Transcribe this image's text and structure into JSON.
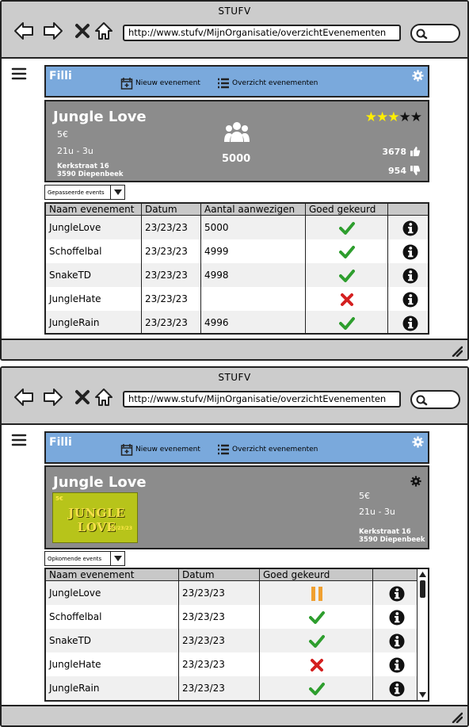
{
  "browser": {
    "title": "STUFV",
    "url": "http://www.stufv/MijnOrganisatie/overzichtEvenementen"
  },
  "app": {
    "brand": "Filli",
    "nav": {
      "new_event": "Nieuw evenement",
      "overview": "Overzicht evenementen"
    }
  },
  "screen1": {
    "event": {
      "title": "Jungle Love",
      "price": "5€",
      "time": "21u - 3u",
      "address_line1": "Kerkstraat 16",
      "address_line2": "3590 Diepenbeek",
      "attendees": "5000",
      "rating": 3,
      "rating_max": 5,
      "likes": "3678",
      "dislikes": "954"
    },
    "filter": "Gepasseerde events",
    "table": {
      "headers": [
        "Naam evenement",
        "Datum",
        "Aantal aanwezigen",
        "Goed gekeurd",
        ""
      ],
      "rows": [
        {
          "name": "JungleLove",
          "date": "23/23/23",
          "count": "5000",
          "status": "approved"
        },
        {
          "name": "Schoffelbal",
          "date": "23/23/23",
          "count": "4999",
          "status": "approved"
        },
        {
          "name": "SnakeTD",
          "date": "23/23/23",
          "count": "4998",
          "status": "approved"
        },
        {
          "name": "JungleHate",
          "date": "23/23/23",
          "count": "",
          "status": "rejected"
        },
        {
          "name": "JungleRain",
          "date": "23/23/23",
          "count": "4996",
          "status": "approved"
        }
      ]
    }
  },
  "screen2": {
    "event": {
      "title": "Jungle Love",
      "price": "5€",
      "time": "21u - 3u",
      "address_line1": "Kerkstraat 16",
      "address_line2": "3590 Diepenbeek",
      "poster_text": "JUNGLE LOVE",
      "poster_sub": "23/23/23",
      "poster_corner": "5€"
    },
    "filter": "Opkomende events",
    "table": {
      "headers": [
        "Naam evenement",
        "Datum",
        "Goed gekeurd",
        ""
      ],
      "rows": [
        {
          "name": "JungleLove",
          "date": "23/23/23",
          "status": "pending"
        },
        {
          "name": "Schoffelbal",
          "date": "23/23/23",
          "status": "approved"
        },
        {
          "name": "SnakeTD",
          "date": "23/23/23",
          "status": "approved"
        },
        {
          "name": "JungleHate",
          "date": "23/23/23",
          "status": "rejected"
        },
        {
          "name": "JungleRain",
          "date": "23/23/23",
          "status": "approved"
        }
      ]
    }
  },
  "colors": {
    "appbar": "#7aa9dc",
    "card": "#8c8c8c",
    "approved": "#2e9e2e",
    "rejected": "#d42020",
    "pending": "#f0a030",
    "star": "#ffee00"
  }
}
